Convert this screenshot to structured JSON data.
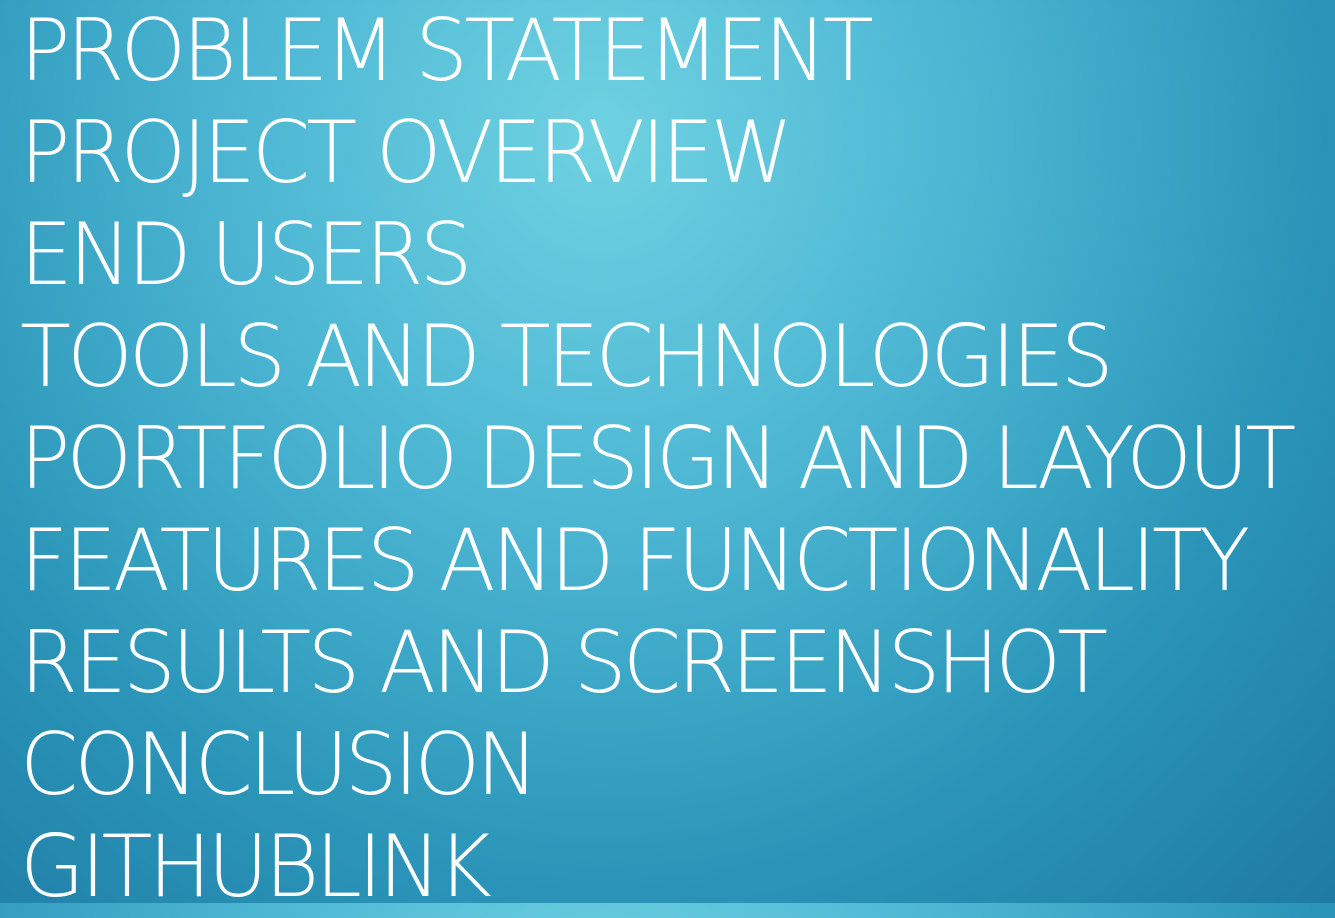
{
  "agenda": {
    "items": [
      "PROBLEM STATEMENT",
      "PROJECT OVERVIEW",
      "END USERS",
      "TOOLS AND TECHNOLOGIES",
      "PORTFOLIO DESIGN AND LAYOUT",
      "FEATURES AND FUNCTIONALITY",
      "RESULTS AND SCREENSHOT",
      "CONCLUSION",
      "GITHUBLINK"
    ]
  },
  "colors": {
    "text": "#ffffff",
    "background_light": "#6fd2e2",
    "background_dark": "#1f7aa3"
  }
}
